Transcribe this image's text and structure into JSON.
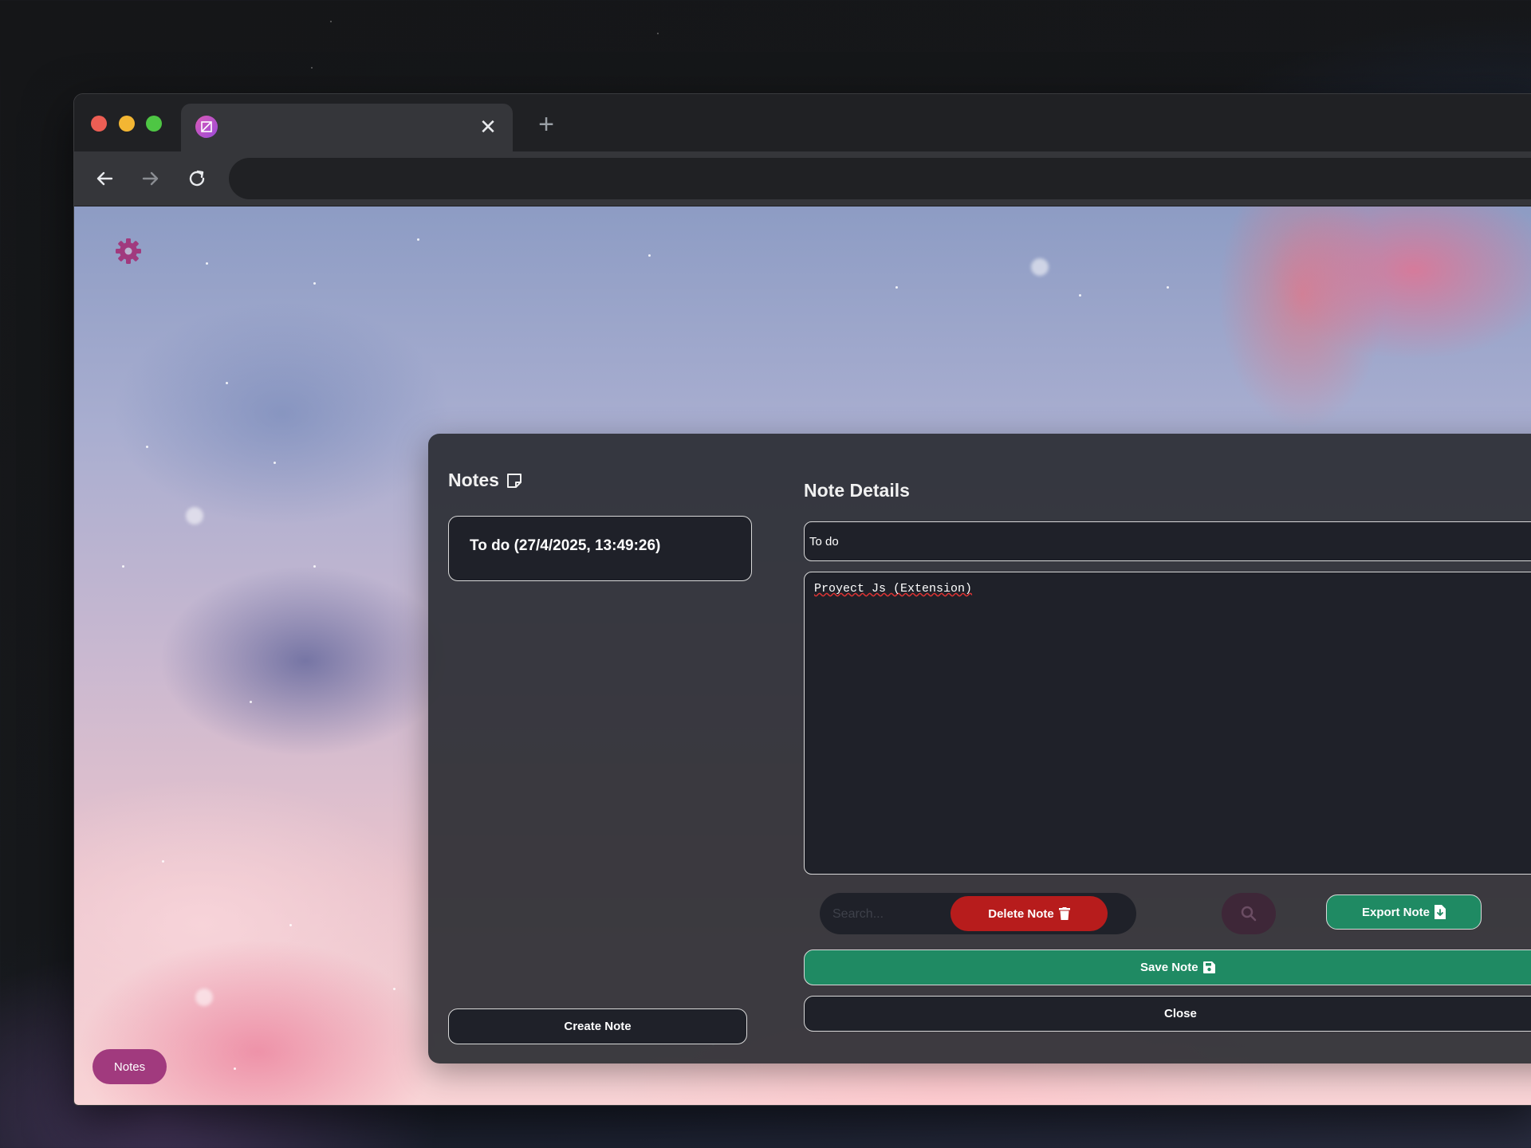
{
  "browser": {
    "tab": {
      "favicon": "notes-app-icon",
      "close_glyph": "✕"
    },
    "new_tab_glyph": "+",
    "nav": {
      "back_icon": "arrow-left-icon",
      "forward_icon": "arrow-right-icon",
      "reload_icon": "reload-icon"
    },
    "omnibox_value": ""
  },
  "page": {
    "settings_icon": "gear-icon",
    "accent_color": "#a13a7e",
    "notes_toggle_label": "Notes"
  },
  "notes_panel": {
    "title": "Notes",
    "title_icon": "note-icon",
    "items": [
      {
        "label": "To do (27/4/2025, 13:49:26)"
      }
    ],
    "create_label": "Create Note"
  },
  "details": {
    "title": "Note Details",
    "title_value": "To do",
    "body_value": "Proyect Js (Extension)",
    "search_placeholder": "Search...",
    "delete_label": "Delete Note",
    "delete_icon": "trash-icon",
    "delete_color": "#b71c1c",
    "search_icon": "magnifier-icon",
    "export_label": "Export Note",
    "export_icon": "file-download-icon",
    "save_label": "Save Note",
    "save_icon": "floppy-disk-icon",
    "save_color": "#1f8a63",
    "close_label": "Close"
  }
}
